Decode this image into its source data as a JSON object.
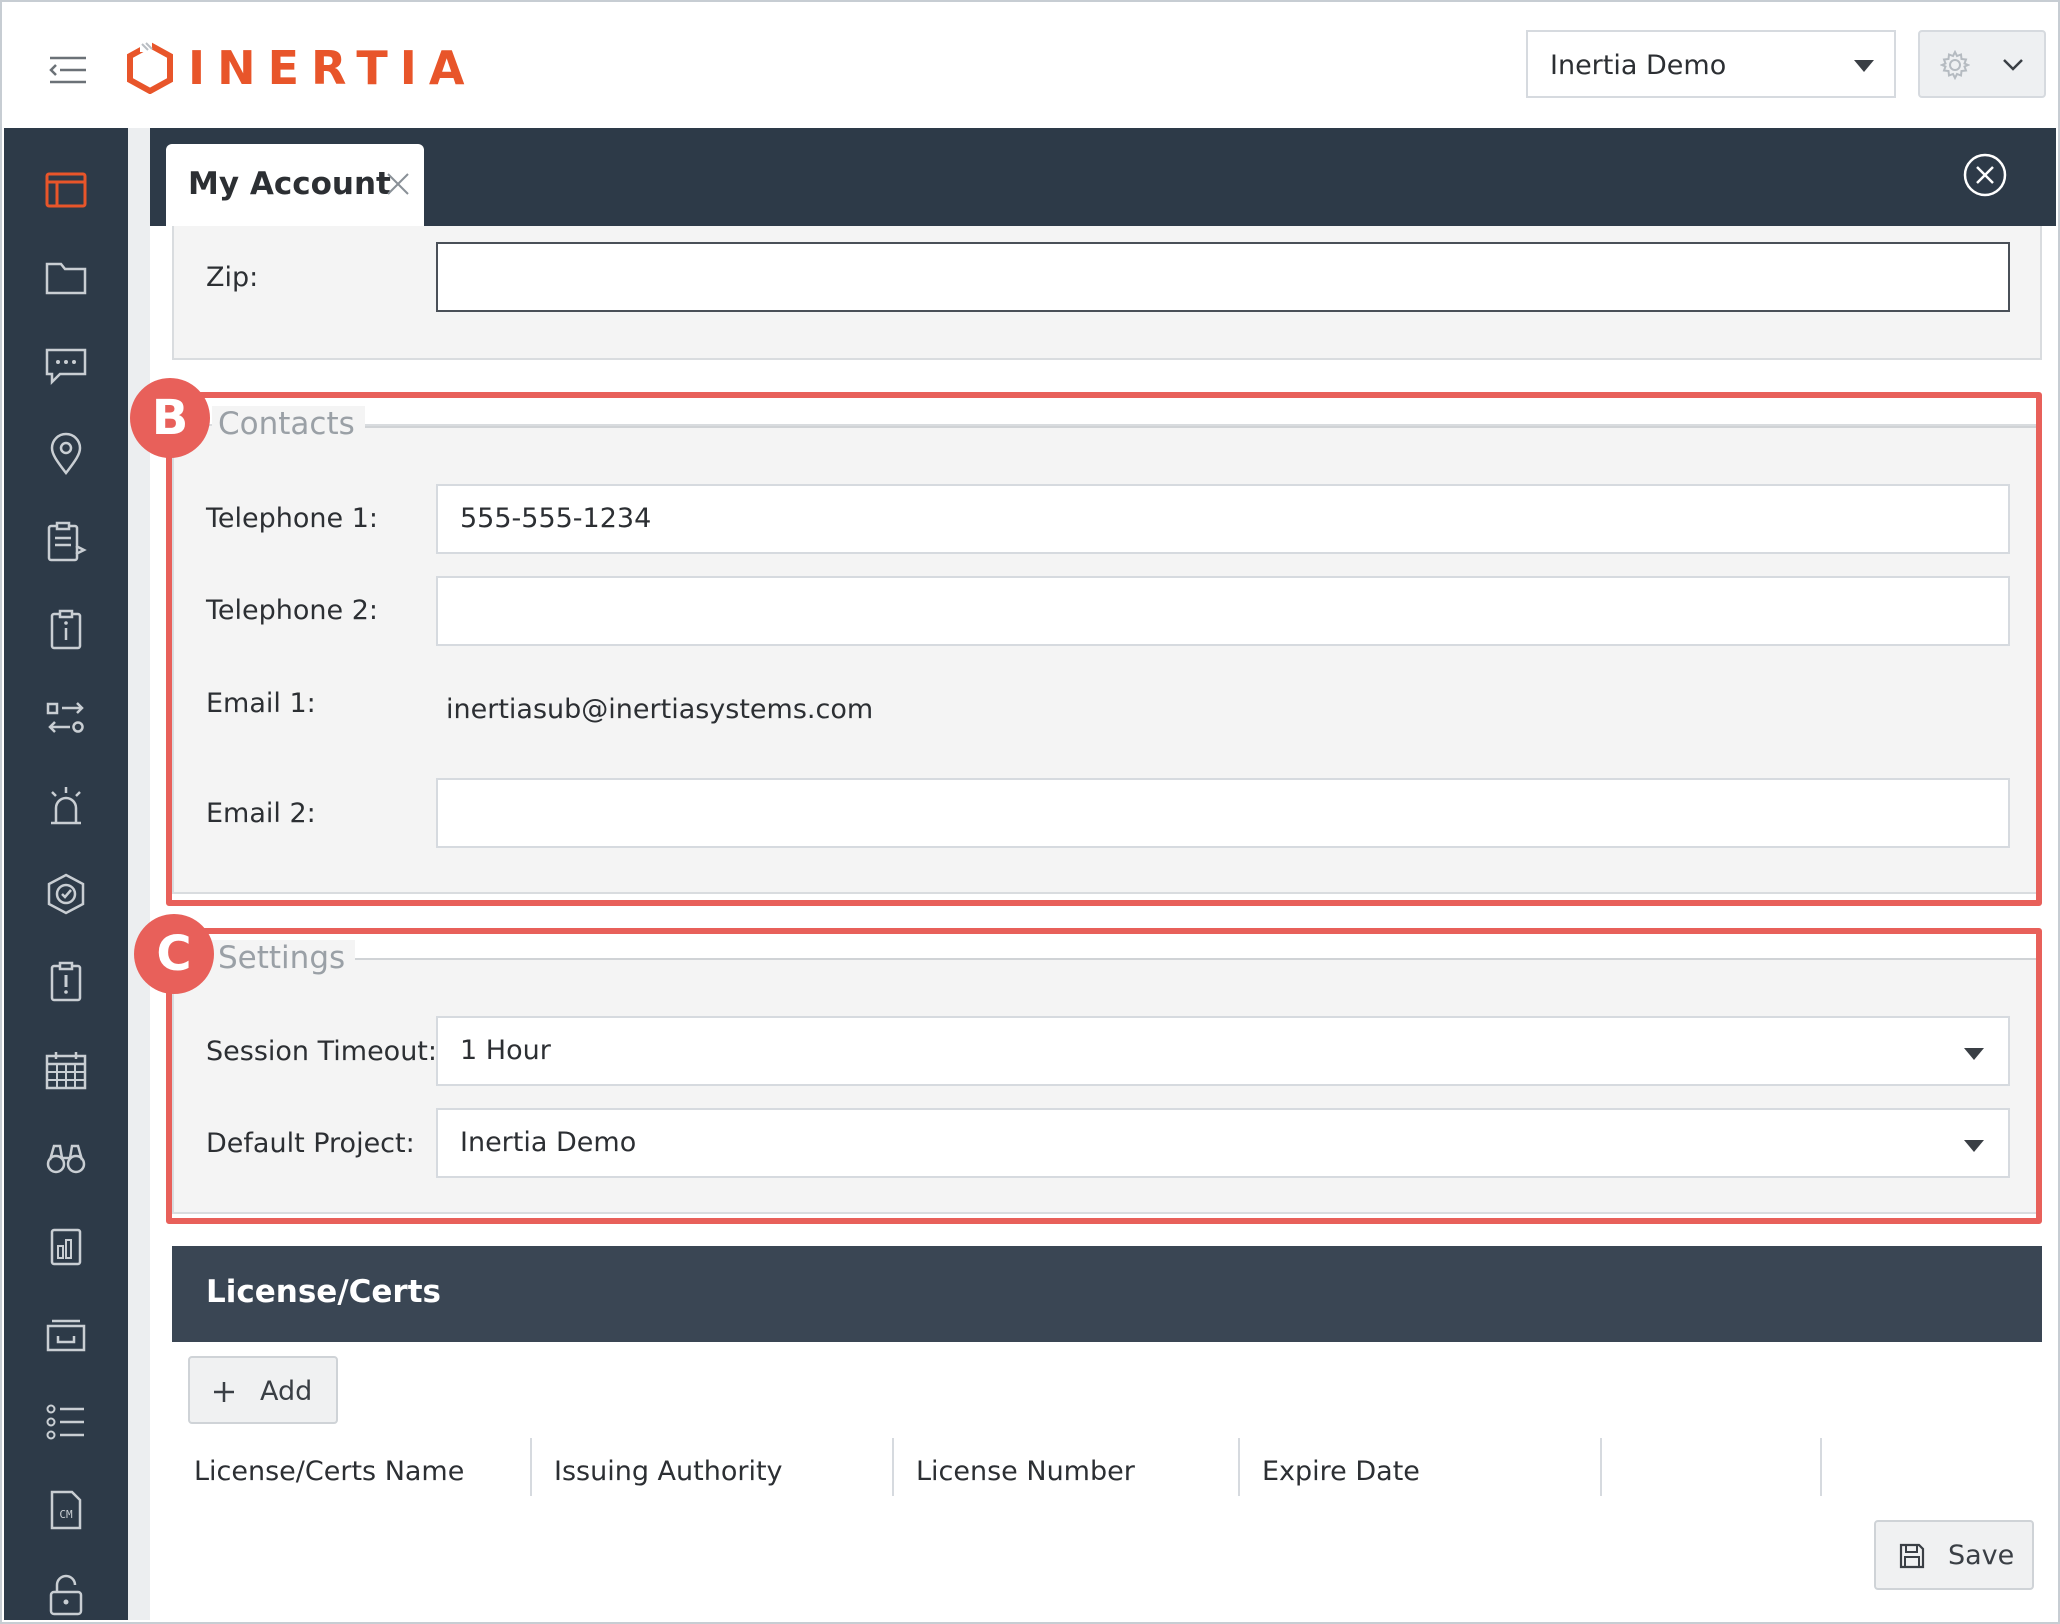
{
  "header": {
    "logo_text": "INERTIA",
    "project_selector": "Inertia Demo"
  },
  "tab": {
    "label": "My Account"
  },
  "address": {
    "zip_label": "Zip:",
    "zip_value": ""
  },
  "contacts": {
    "legend": "Contacts",
    "badge": "B",
    "telephone1_label": "Telephone 1:",
    "telephone1_value": "555-555-1234",
    "telephone2_label": "Telephone 2:",
    "telephone2_value": "",
    "email1_label": "Email 1:",
    "email1_value": "inertiasub@inertiasystems.com",
    "email2_label": "Email 2:",
    "email2_value": ""
  },
  "settings": {
    "legend": "Settings",
    "badge": "C",
    "session_timeout_label": "Session Timeout:",
    "session_timeout_value": "1 Hour",
    "default_project_label": "Default Project:",
    "default_project_value": "Inertia Demo"
  },
  "license": {
    "title": "License/Certs",
    "add_label": "Add",
    "columns": [
      "License/Certs Name",
      "Issuing Authority",
      "License Number",
      "Expire Date"
    ]
  },
  "footer": {
    "save_label": "Save"
  },
  "colors": {
    "brand": "#e8552a",
    "sidebar": "#2d3a48",
    "highlight": "#e8605a"
  },
  "sidebar_icons": [
    "dashboard-icon",
    "folder-icon",
    "chat-icon",
    "location-icon",
    "submittal-icon",
    "info-clipboard-icon",
    "transfer-icon",
    "alarm-icon",
    "check-shield-icon",
    "alert-icon",
    "calendar-icon",
    "binoculars-icon",
    "report-icon",
    "inbox-icon",
    "list-icon",
    "cm-document-icon",
    "lock-icon"
  ]
}
